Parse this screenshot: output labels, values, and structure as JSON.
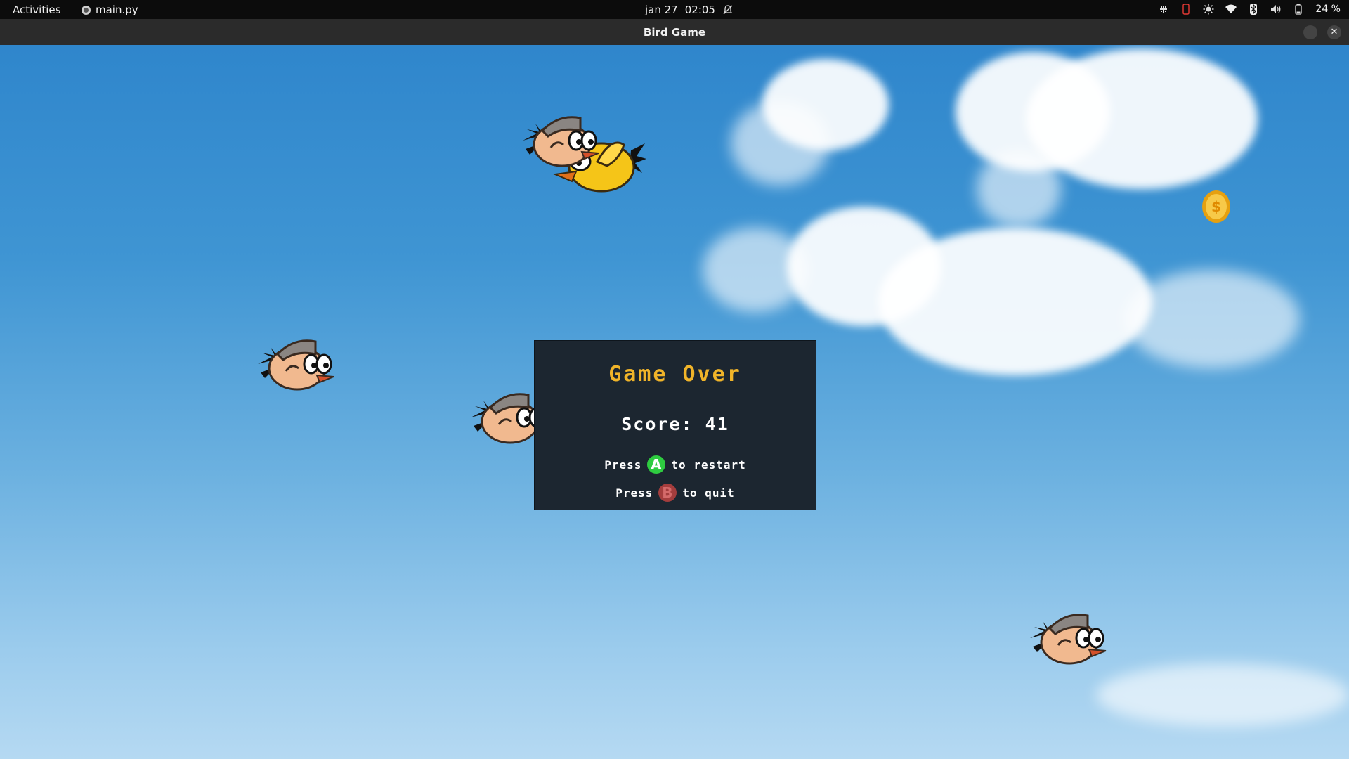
{
  "system_bar": {
    "activities": "Activities",
    "app_name": "main.py",
    "date": "jan 27",
    "time": "02:05",
    "battery_percent": "24 %"
  },
  "window": {
    "title": "Bird Game"
  },
  "game_over": {
    "title": "Game Over",
    "score_label": "Score:",
    "score_value": "41",
    "restart_prefix": "Press",
    "restart_button": "A",
    "restart_suffix": "to restart",
    "quit_prefix": "Press",
    "quit_button": "B",
    "quit_suffix": "to quit"
  },
  "colors": {
    "title_color": "#f0b429",
    "panel_bg": "#1c2630",
    "button_a": "#2ecc40",
    "button_b": "#a43d3d"
  },
  "icons": [
    "bell-off-icon",
    "settings-icon",
    "phone-icon",
    "brightness-icon",
    "wifi-icon",
    "bluetooth-icon",
    "volume-icon",
    "battery-icon",
    "minimize-icon",
    "close-icon",
    "coin-icon"
  ]
}
